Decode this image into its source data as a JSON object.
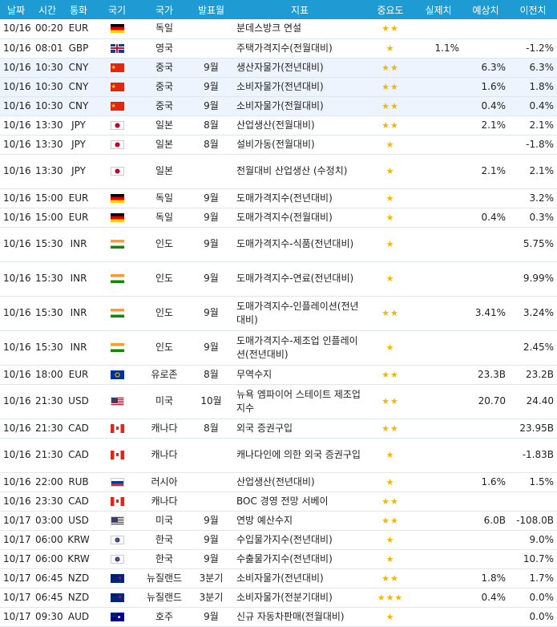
{
  "headers": [
    "날짜",
    "시간",
    "통화",
    "국기",
    "국가",
    "발표월",
    "지표",
    "중요도",
    "실제치",
    "예상치",
    "이전치"
  ],
  "star_glyph": "★",
  "rows": [
    {
      "date": "10/16",
      "time": "00:20",
      "cur": "EUR",
      "flag": "de",
      "country": "독일",
      "month": "",
      "indicator": "분데스방크 연설",
      "stars": "★★",
      "actual": "",
      "forecast": "",
      "previous": "",
      "tall": false,
      "hl": false
    },
    {
      "date": "10/16",
      "time": "08:01",
      "cur": "GBP",
      "flag": "gb",
      "country": "영국",
      "month": "",
      "indicator": "주택가격지수(전월대비)",
      "stars": "★",
      "actual": "1.1%",
      "forecast": "",
      "previous": "-1.2%",
      "tall": false,
      "hl": false
    },
    {
      "date": "10/16",
      "time": "10:30",
      "cur": "CNY",
      "flag": "cn",
      "country": "중국",
      "month": "9월",
      "indicator": "생산자물가(전년대비)",
      "stars": "★★",
      "actual": "",
      "forecast": "6.3%",
      "previous": "6.3%",
      "tall": false,
      "hl": true
    },
    {
      "date": "10/16",
      "time": "10:30",
      "cur": "CNY",
      "flag": "cn",
      "country": "중국",
      "month": "9월",
      "indicator": "소비자물가(전년대비)",
      "stars": "★★",
      "actual": "",
      "forecast": "1.6%",
      "previous": "1.8%",
      "tall": false,
      "hl": true
    },
    {
      "date": "10/16",
      "time": "10:30",
      "cur": "CNY",
      "flag": "cn",
      "country": "중국",
      "month": "9월",
      "indicator": "소비자물가(전월대비)",
      "stars": "★★",
      "actual": "",
      "forecast": "0.4%",
      "previous": "0.4%",
      "tall": false,
      "hl": true
    },
    {
      "date": "10/16",
      "time": "13:30",
      "cur": "JPY",
      "flag": "jp",
      "country": "일본",
      "month": "8월",
      "indicator": "산업생산(전월대비)",
      "stars": "★★",
      "actual": "",
      "forecast": "2.1%",
      "previous": "2.1%",
      "tall": false,
      "hl": false
    },
    {
      "date": "10/16",
      "time": "13:30",
      "cur": "JPY",
      "flag": "jp",
      "country": "일본",
      "month": "8월",
      "indicator": "설비가동(전월대비)",
      "stars": "★",
      "actual": "",
      "forecast": "",
      "previous": "-1.8%",
      "tall": false,
      "hl": false
    },
    {
      "date": "10/16",
      "time": "13:30",
      "cur": "JPY",
      "flag": "jp",
      "country": "일본",
      "month": "",
      "indicator": "전월대비 산업생산 (수정치)",
      "stars": "★",
      "actual": "",
      "forecast": "2.1%",
      "previous": "2.1%",
      "tall": true,
      "hl": false
    },
    {
      "date": "10/16",
      "time": "15:00",
      "cur": "EUR",
      "flag": "de",
      "country": "독일",
      "month": "9월",
      "indicator": "도매가격지수(전년대비)",
      "stars": "★",
      "actual": "",
      "forecast": "",
      "previous": "3.2%",
      "tall": false,
      "hl": false
    },
    {
      "date": "10/16",
      "time": "15:00",
      "cur": "EUR",
      "flag": "de",
      "country": "독일",
      "month": "9월",
      "indicator": "도매가격지수(전월대비)",
      "stars": "★",
      "actual": "",
      "forecast": "0.4%",
      "previous": "0.3%",
      "tall": false,
      "hl": false
    },
    {
      "date": "10/16",
      "time": "15:30",
      "cur": "INR",
      "flag": "in",
      "country": "인도",
      "month": "9월",
      "indicator": "도매가격지수-식품(전년대비)",
      "stars": "★",
      "actual": "",
      "forecast": "",
      "previous": "5.75%",
      "tall": true,
      "hl": false
    },
    {
      "date": "10/16",
      "time": "15:30",
      "cur": "INR",
      "flag": "in",
      "country": "인도",
      "month": "9월",
      "indicator": "도매가격지수-연료(전년대비)",
      "stars": "★",
      "actual": "",
      "forecast": "",
      "previous": "9.99%",
      "tall": true,
      "hl": false
    },
    {
      "date": "10/16",
      "time": "15:30",
      "cur": "INR",
      "flag": "in",
      "country": "인도",
      "month": "9월",
      "indicator": "도매가격지수-인플레이션(전년대비)",
      "stars": "★★",
      "actual": "",
      "forecast": "3.41%",
      "previous": "3.24%",
      "tall": true,
      "hl": false
    },
    {
      "date": "10/16",
      "time": "15:30",
      "cur": "INR",
      "flag": "in",
      "country": "인도",
      "month": "9월",
      "indicator": "도매가격지수-제조업 인플레이션(전년대비)",
      "stars": "★",
      "actual": "",
      "forecast": "",
      "previous": "2.45%",
      "tall": true,
      "hl": false
    },
    {
      "date": "10/16",
      "time": "18:00",
      "cur": "EUR",
      "flag": "eu",
      "country": "유로존",
      "month": "8월",
      "indicator": "무역수지",
      "stars": "★★",
      "actual": "",
      "forecast": "23.3B",
      "previous": "23.2B",
      "tall": false,
      "hl": false
    },
    {
      "date": "10/16",
      "time": "21:30",
      "cur": "USD",
      "flag": "us",
      "country": "미국",
      "month": "10월",
      "indicator": "뉴욕 엠파이어 스테이트 제조업 지수",
      "stars": "★★",
      "actual": "",
      "forecast": "20.70",
      "previous": "24.40",
      "tall": true,
      "hl": false
    },
    {
      "date": "10/16",
      "time": "21:30",
      "cur": "CAD",
      "flag": "ca",
      "country": "캐나다",
      "month": "8월",
      "indicator": "외국 증권구입",
      "stars": "★★",
      "actual": "",
      "forecast": "",
      "previous": "23.95B",
      "tall": false,
      "hl": false
    },
    {
      "date": "10/16",
      "time": "21:30",
      "cur": "CAD",
      "flag": "ca",
      "country": "캐나다",
      "month": "",
      "indicator": "캐나다인에 의한 외국 증권구입",
      "stars": "★",
      "actual": "",
      "forecast": "",
      "previous": "-1.83B",
      "tall": true,
      "hl": false
    },
    {
      "date": "10/16",
      "time": "22:00",
      "cur": "RUB",
      "flag": "ru",
      "country": "러시아",
      "month": "",
      "indicator": "산업생산(전년대비)",
      "stars": "★",
      "actual": "",
      "forecast": "1.6%",
      "previous": "1.5%",
      "tall": false,
      "hl": false
    },
    {
      "date": "10/16",
      "time": "23:30",
      "cur": "CAD",
      "flag": "ca",
      "country": "캐나다",
      "month": "",
      "indicator": "BOC 경영 전망 서베이",
      "stars": "★★",
      "actual": "",
      "forecast": "",
      "previous": "",
      "tall": false,
      "hl": false
    },
    {
      "date": "10/17",
      "time": "03:00",
      "cur": "USD",
      "flag": "us",
      "country": "미국",
      "month": "9월",
      "indicator": "연방 예산수지",
      "stars": "★★",
      "actual": "",
      "forecast": "6.0B",
      "previous": "-108.0B",
      "tall": false,
      "hl": false
    },
    {
      "date": "10/17",
      "time": "06:00",
      "cur": "KRW",
      "flag": "kr",
      "country": "한국",
      "month": "9월",
      "indicator": "수입물가지수(전년대비)",
      "stars": "★",
      "actual": "",
      "forecast": "",
      "previous": "9.0%",
      "tall": false,
      "hl": false
    },
    {
      "date": "10/17",
      "time": "06:00",
      "cur": "KRW",
      "flag": "kr",
      "country": "한국",
      "month": "9월",
      "indicator": "수출물가지수(전년대비)",
      "stars": "★",
      "actual": "",
      "forecast": "",
      "previous": "10.7%",
      "tall": false,
      "hl": false
    },
    {
      "date": "10/17",
      "time": "06:45",
      "cur": "NZD",
      "flag": "nz",
      "country": "뉴질랜드",
      "month": "3분기",
      "indicator": "소비자물가(전년대비)",
      "stars": "★★",
      "actual": "",
      "forecast": "1.8%",
      "previous": "1.7%",
      "tall": false,
      "hl": false
    },
    {
      "date": "10/17",
      "time": "06:45",
      "cur": "NZD",
      "flag": "nz",
      "country": "뉴질랜드",
      "month": "3분기",
      "indicator": "소비자물가(전분기대비)",
      "stars": "★★★",
      "actual": "",
      "forecast": "0.4%",
      "previous": "0.0%",
      "tall": false,
      "hl": false
    },
    {
      "date": "10/17",
      "time": "09:30",
      "cur": "AUD",
      "flag": "au",
      "country": "호주",
      "month": "9월",
      "indicator": "신규 자동차판매(전월대비)",
      "stars": "★",
      "actual": "",
      "forecast": "",
      "previous": "0.0%",
      "tall": false,
      "hl": false
    }
  ]
}
